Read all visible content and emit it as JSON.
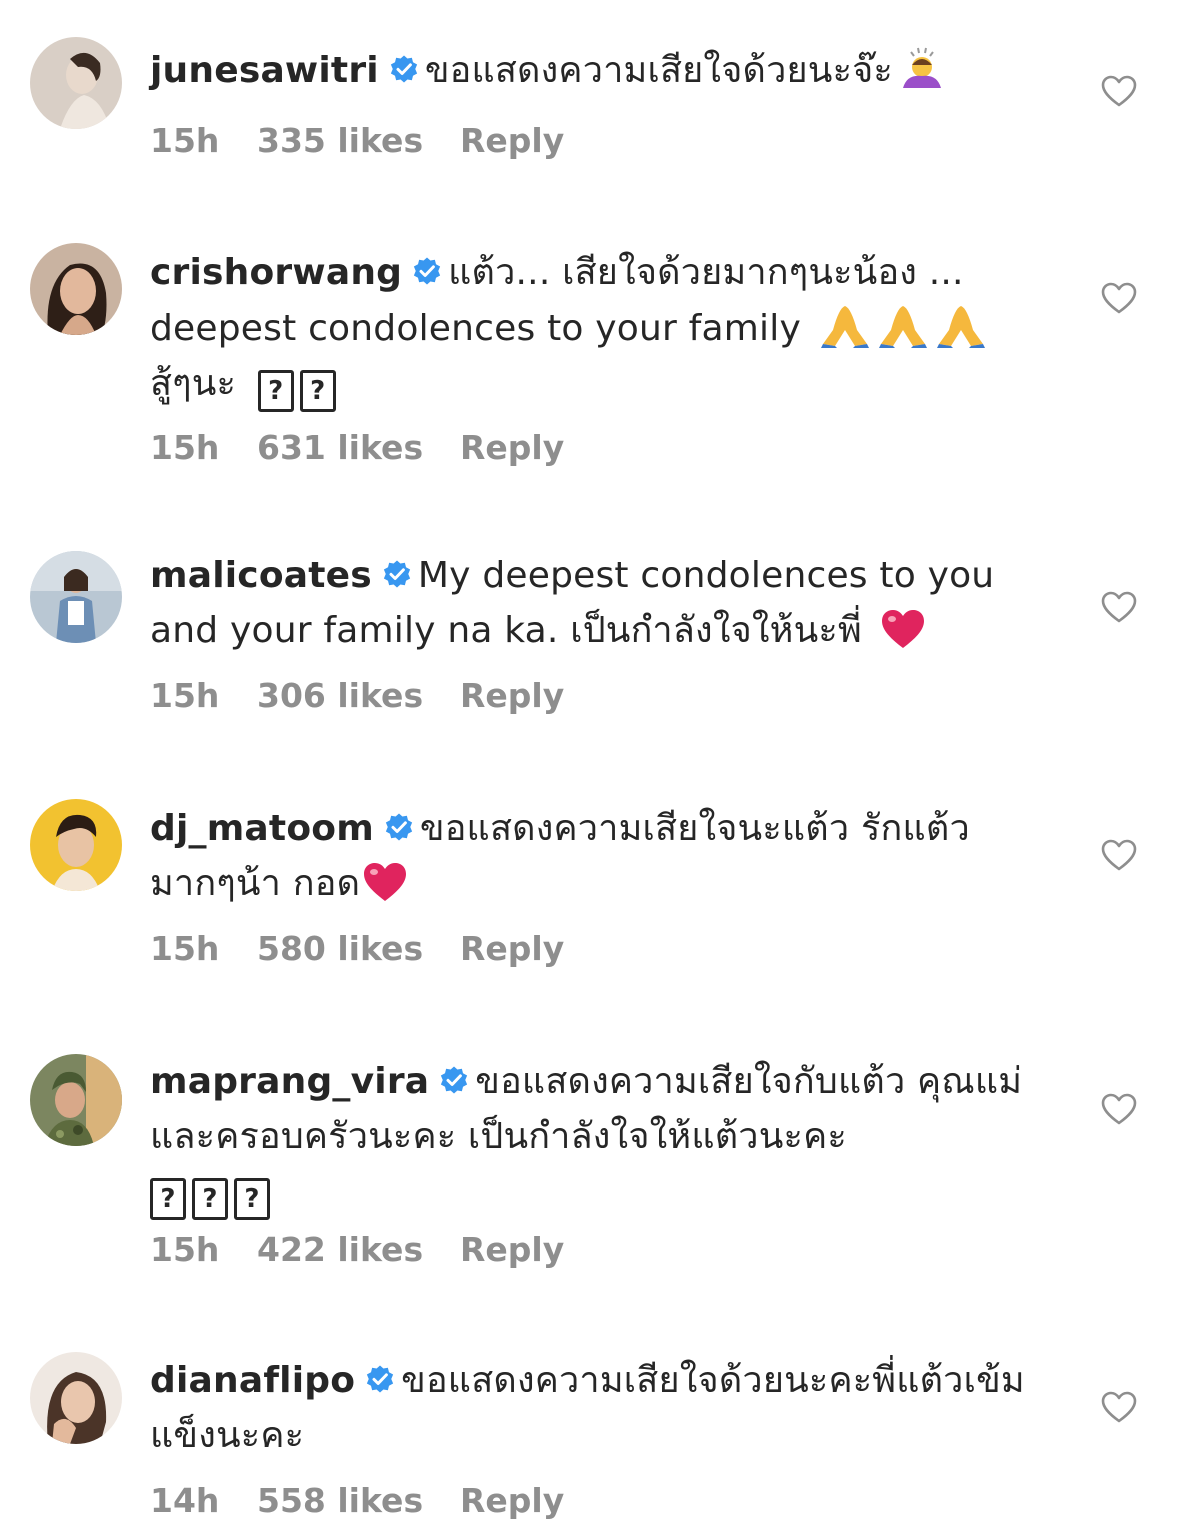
{
  "colors": {
    "text": "#262626",
    "secondary": "#8e8e8e",
    "verified": "#3897f0",
    "heart_red": "#e0245e"
  },
  "icons": {
    "verified": "verified-badge-icon",
    "like": "heart-outline-icon",
    "pray": "folded-hands-emoji",
    "heart": "red-heart-emoji",
    "bow": "person-bowing-emoji",
    "missing": "missing-glyph-box"
  },
  "comments": [
    {
      "username": "junesawitri",
      "text": "ขอแสดงความเสียใจด้วยนะจ๊ะ",
      "emoji": "person-bowing-emoji",
      "time": "15h",
      "likes": "335 likes",
      "reply": "Reply"
    },
    {
      "username": "crishorwang",
      "text_1": "แต้ว... เสียใจด้วยมากๆนะน้อง ... deepest condolences to your family",
      "text_2": "สู้ๆนะ",
      "missing_glyph": "?",
      "time": "15h",
      "likes": "631 likes",
      "reply": "Reply"
    },
    {
      "username": "malicoates",
      "text": "My deepest condolences to you and your family na ka. เป็นกำลังใจให้นะพี่",
      "time": "15h",
      "likes": "306 likes",
      "reply": "Reply"
    },
    {
      "username": "dj_matoom",
      "text": "ขอแสดงความเสียใจนะแต้ว รักแต้วมากๆน้า กอด",
      "time": "15h",
      "likes": "580 likes",
      "reply": "Reply"
    },
    {
      "username": "maprang_vira",
      "text": "ขอแสดงความเสียใจกับแต้ว คุณแม่ และครอบครัวนะคะ เป็นกำลังใจให้แต้วนะคะ",
      "missing_glyph": "?",
      "time": "15h",
      "likes": "422 likes",
      "reply": "Reply"
    },
    {
      "username": "dianaflipo",
      "text": "ขอแสดงความเสียใจด้วยนะคะพี่แต้วเข้มแข็งนะคะ",
      "time": "14h",
      "likes": "558 likes",
      "reply": "Reply"
    }
  ]
}
